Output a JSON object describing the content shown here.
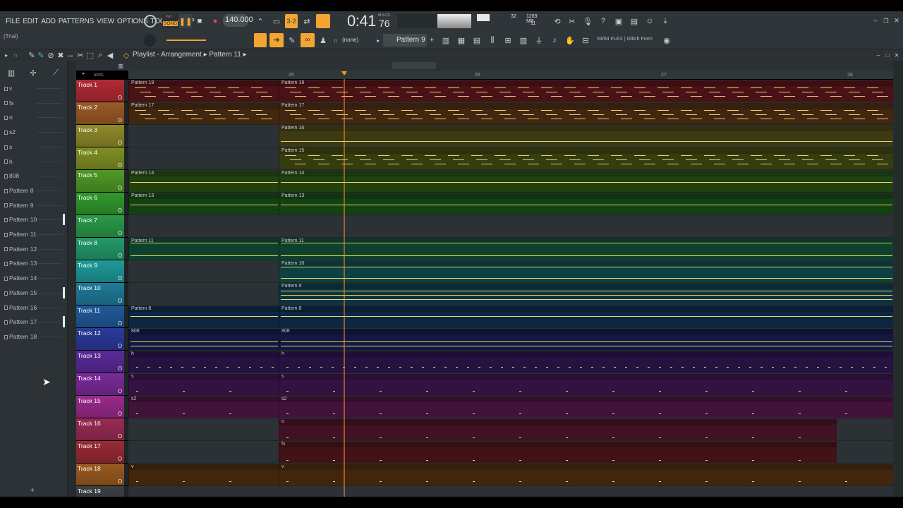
{
  "menu": [
    "FILE",
    "EDIT",
    "ADD",
    "PATTERNS",
    "VIEW",
    "OPTIONS",
    "TOOLS",
    "HELP"
  ],
  "mode": {
    "pat": "PAT",
    "song": "SONG"
  },
  "tempo": "140.000",
  "time": "0:41",
  "time_sub": "76",
  "time_unit": "M:S:CS",
  "cpu": "32",
  "memory": "1269 MB",
  "voices": "11",
  "trial": "(Trial)",
  "snap": "(none)",
  "pattern_selector": "Pattern 9",
  "news": "03/04  FLEX | Glitch Form",
  "breadcrumb": {
    "part1": "Playlist - Arrangement",
    "part2": "Pattern 11"
  },
  "picker": {
    "note_tab": "NOTE",
    "items": [
      "v",
      "fx",
      "o",
      "s2",
      "s",
      "h",
      "808",
      "Pattern 8",
      "Pattern 9",
      "Pattern 10",
      "Pattern 11",
      "Pattern 12",
      "Pattern 13",
      "Pattern 14",
      "Pattern 15",
      "Pattern 16",
      "Pattern 17",
      "Pattern 18"
    ],
    "add": "+"
  },
  "ruler": [
    "25",
    "26",
    "27",
    "28"
  ],
  "tracks": [
    {
      "name": "Track 1",
      "color": "#b02a35",
      "clips": [
        {
          "label": "Pattern 18"
        },
        {
          "label": "Pattern 18"
        }
      ]
    },
    {
      "name": "Track 2",
      "color": "#9a5a25",
      "clips": [
        {
          "label": "Pattern 17"
        },
        {
          "label": "Pattern 17"
        }
      ]
    },
    {
      "name": "Track 3",
      "color": "#8f8a2a",
      "clips": [
        {
          "label": "Pattern 16"
        }
      ]
    },
    {
      "name": "Track 4",
      "color": "#7f8f22",
      "clips": [
        {
          "label": "Pattern 15"
        }
      ]
    },
    {
      "name": "Track 5",
      "color": "#4f9a25",
      "clips": [
        {
          "label": "Pattern 14"
        },
        {
          "label": "Pattern 14"
        }
      ]
    },
    {
      "name": "Track 6",
      "color": "#2f9a2a",
      "clips": [
        {
          "label": "Pattern 13"
        },
        {
          "label": "Pattern 13"
        }
      ]
    },
    {
      "name": "Track 7",
      "color": "#2a9a4a",
      "clips": []
    },
    {
      "name": "Track 8",
      "color": "#229a6a",
      "clips": [
        {
          "label": "Pattern 11"
        },
        {
          "label": "Pattern 11"
        }
      ]
    },
    {
      "name": "Track 9",
      "color": "#1f9a9a",
      "clips": [
        {
          "label": "Pattern 10"
        }
      ]
    },
    {
      "name": "Track 10",
      "color": "#1f7a9a",
      "clips": [
        {
          "label": "Pattern 9"
        }
      ]
    },
    {
      "name": "Track 11",
      "color": "#1f5a9a",
      "clips": [
        {
          "label": "Pattern 8"
        },
        {
          "label": "Pattern 8"
        }
      ]
    },
    {
      "name": "Track 12",
      "color": "#2a3a9a",
      "clips": [
        {
          "label": "808"
        },
        {
          "label": "808"
        }
      ]
    },
    {
      "name": "Track 13",
      "color": "#5a2a9a",
      "clips": [
        {
          "label": "h"
        },
        {
          "label": "h"
        }
      ]
    },
    {
      "name": "Track 14",
      "color": "#7a2a9a",
      "clips": [
        {
          "label": "s"
        },
        {
          "label": "s"
        }
      ]
    },
    {
      "name": "Track 15",
      "color": "#9a2a8a",
      "clips": [
        {
          "label": "s2"
        },
        {
          "label": "s2"
        }
      ]
    },
    {
      "name": "Track 16",
      "color": "#9a2a55",
      "clips": [
        {
          "label": "o"
        }
      ]
    },
    {
      "name": "Track 17",
      "color": "#9a2a35",
      "clips": [
        {
          "label": "fx"
        }
      ]
    },
    {
      "name": "Track 18",
      "color": "#9a5a20",
      "clips": [
        {
          "label": "v"
        },
        {
          "label": "v"
        }
      ]
    },
    {
      "name": "Track 19",
      "color": "#3a4044",
      "clips": []
    }
  ]
}
